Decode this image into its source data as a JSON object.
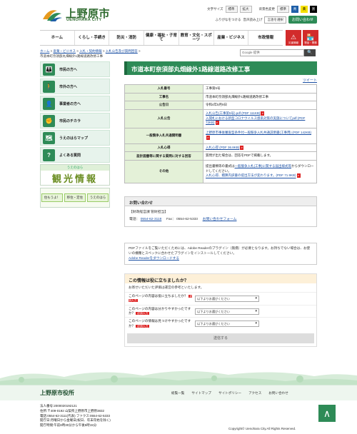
{
  "header": {
    "logo_title": "上野原市",
    "logo_sub": "UENOHARA CITY",
    "font_size_label": "文字サイズ",
    "font_standard": "標準",
    "font_large": "拡大",
    "bg_color_label": "背景色変更",
    "bg_standard": "標準",
    "bg_blue": "青",
    "bg_yellow": "黄",
    "bg_black": "黒",
    "furigana": "ふりがなをつける",
    "read_aloud": "音声読み上げ",
    "language": "言語を選択",
    "contact": "お問い合わせ"
  },
  "nav": [
    "ホーム",
    "くらし・手続き",
    "防災・消防",
    "健康・福祉・子育て",
    "教育・文化・スポーツ",
    "産業・ビジネス",
    "市政情報"
  ],
  "alerts": {
    "disaster": "災害情報",
    "shop": "物品・業務"
  },
  "breadcrumb": {
    "items": [
      "ホーム",
      "産業・ビジネス",
      "入札・契約情報",
      "入札公告及び質問回答"
    ],
    "current": "市道本町奈須部丸畑線外1路線道路改修工事"
  },
  "search": {
    "placeholder": "Google 提供",
    "button": "🔍"
  },
  "sidebar": {
    "items": [
      {
        "label": "市民の方へ",
        "icon": "👪"
      },
      {
        "label": "市外の方へ",
        "icon": "🚶"
      },
      {
        "label": "事業者の方へ",
        "icon": "👤"
      },
      {
        "label": "市民のチカラ",
        "icon": "✊"
      },
      {
        "label": "うえのはらマップ",
        "icon": "🗺"
      },
      {
        "label": "よくある質問",
        "icon": "?"
      }
    ],
    "banner_tourism_top": "うえのはら",
    "banner_tourism_big": "観光情報",
    "banner_live_1": "住もうよ！",
    "banner_live_2": "移住・定住",
    "banner_live_3": "うえのはら"
  },
  "main": {
    "title": "市道本町奈須部丸畑線外1路線道路改修工事",
    "tweet": "ツイート",
    "rows": [
      {
        "label": "入札番号",
        "value": "工事第5号"
      },
      {
        "label": "工事名",
        "value": "市道本町奈須部丸畑線外1路線道路改修工事"
      },
      {
        "label": "公告日",
        "value": "令和4年5月9日"
      }
    ],
    "notice_label": "入札公告",
    "notice_link1": "入札公告(工事第5号).pdf (PDF 111KB)",
    "notice_link2": "入開札における新型コロナウイルス感染対策の実施についてpdf (PDF 72KB)",
    "req_label": "一般競争入札共通開明書",
    "req_link": "上野原市事後審査型条件付一般競争入札共通説明書(工事用) (PDF 142KB)",
    "form_label": "入札心得",
    "form_link": "入札心得 (PDF 36.8KB)",
    "design_label": "設計図書等に関する質問に対する回答",
    "design_value": "質問が出た場合は、回答をPDFで掲載します。",
    "other_label": "その他",
    "other_text1": "提出書類等の書式は",
    "other_link1": "一般競争入札(工事)に関する届出様式等",
    "other_text2": "からダウンロードしてください。",
    "other_link2": "入札心得、積算内訳書の提出方法が変わります。(PDF 71.9KB)"
  },
  "contact": {
    "heading": "お問い合わせ",
    "dept": "【財政経営課 管財担当】",
    "phone_label": "電話：",
    "phone": "0554-62-3118",
    "fax_label": "Fax：",
    "fax": "0554-62-5333",
    "form_link": "お問い合わせフォーム"
  },
  "pdf_note": {
    "text": "PDFファイルをご覧いただくためには、Adobe Readerのプラグイン（無償）が必要となります。お持ちでない場合は、お使いの機種とスペックに合わせたプラグインをインストールしてください。",
    "link": "Adobe Readerをダウンロードする"
  },
  "survey": {
    "heading": "この情報は役に立ちましたか？",
    "note": "お寄せいただいた評価は運営の参考といたします。",
    "questions": [
      {
        "q": "このページの内容は役に立ちましたか？",
        "req": "必須入力",
        "select": "以下よりお選びください"
      },
      {
        "q": "このページの内容は分かりやすかったですか？",
        "req": "必須入力",
        "select": "以下よりお選びください"
      },
      {
        "q": "このページの情報は見つけやすかったですか？",
        "req": "必須入力",
        "select": "以下よりお選びください"
      }
    ],
    "submit": "送信する"
  },
  "footer": {
    "logo": "上野原市役所",
    "links": [
      "総覧一覧",
      "サイトマップ",
      "サイトポリシー",
      "アクセス",
      "お問い合わせ"
    ],
    "info": [
      "法人番号:2000020192121",
      "住所:〒409-0192 山梨県上野原市上野原3832",
      "電話:0554-62-3111(代表) ファクス:0554-62-5333",
      "開庁日:月曜日から金曜日(祝日、年末年始を除く)",
      "開庁時間:午前8時30分から午後5時15分"
    ],
    "copyright": "Copyright© Uenohara City.All Rights Reserved.",
    "pagetop": "∧"
  },
  "colors": {
    "accent": "#2e8b57",
    "alert": "#d22b2b",
    "link": "#1a4fa3"
  }
}
